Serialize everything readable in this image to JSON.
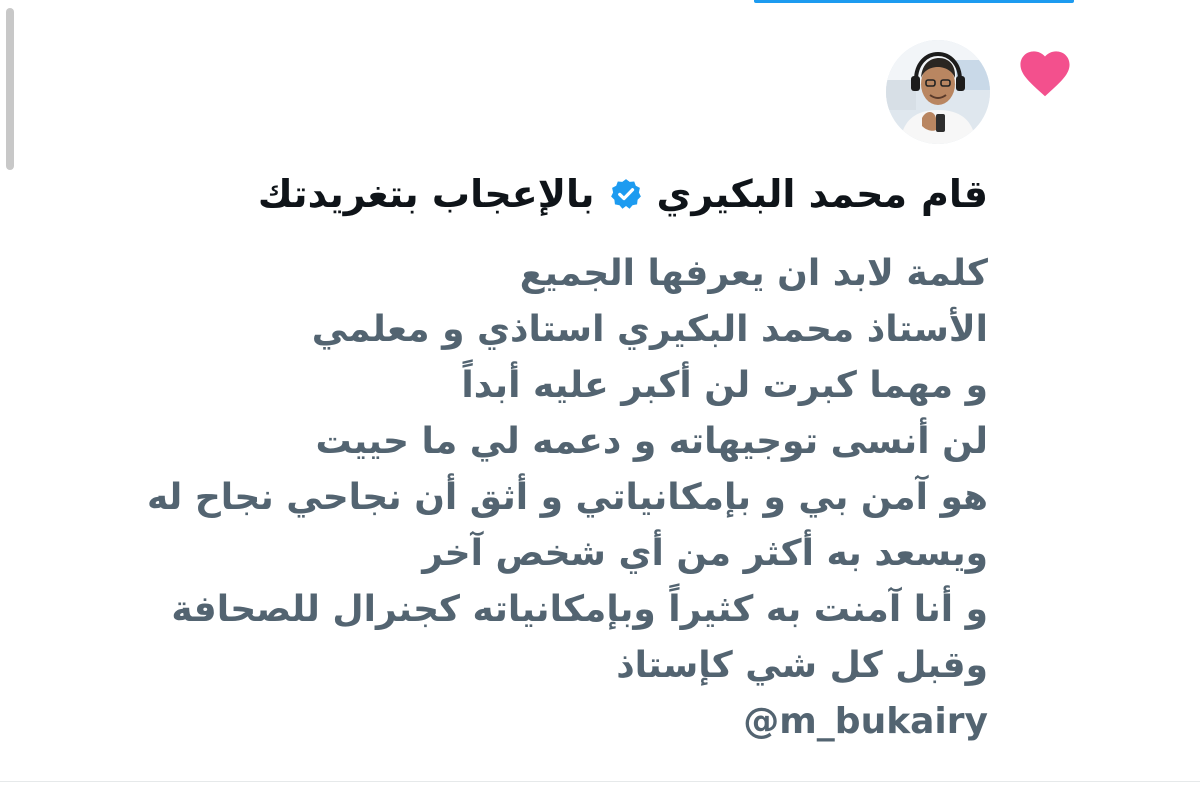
{
  "notification": {
    "type_icon": "heart-icon",
    "type_icon_color": "#f3508d",
    "user_name": "محمد البكيري",
    "prefix": "قام",
    "suffix": "بالإعجاب بتغريدتك",
    "verified_icon": "verified-badge-icon",
    "verified_color": "#1d9bf0"
  },
  "tweet": {
    "lines": [
      "كلمة لابد ان يعرفها الجميع",
      "الأستاذ محمد البكيري استاذي و معلمي",
      "و مهما كبرت لن أكبر عليه أبداً",
      "لن أنسى توجيهاته و دعمه لي ما حييت",
      "هو آمن بي و بإمكانياتي و أثق أن نجاحي نجاح له",
      "ويسعد به أكثر من أي شخص آخر",
      "و أنا آمنت به كثيراً وبإمكانياته كجنرال للصحافة",
      "وقبل كل شي كإستاذ"
    ],
    "mention": "@m_bukairy",
    "text_color": "#536471"
  }
}
